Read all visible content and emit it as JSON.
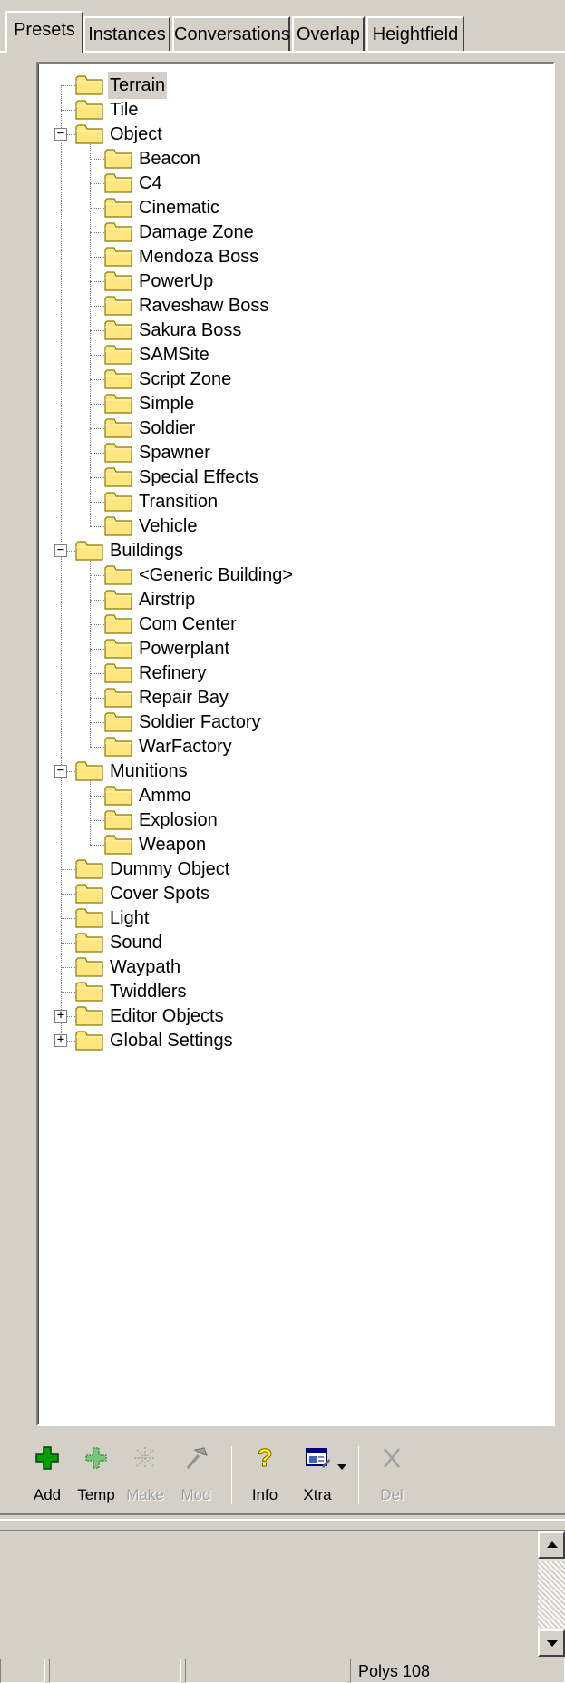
{
  "tabs": [
    {
      "label": "Presets",
      "active": true
    },
    {
      "label": "Instances",
      "active": false
    },
    {
      "label": "Conversations",
      "active": false
    },
    {
      "label": "Overlap",
      "active": false
    },
    {
      "label": "Heightfield",
      "active": false
    }
  ],
  "tree": {
    "selected": "Terrain",
    "items": [
      {
        "label": "Terrain",
        "depth": 0,
        "expander": null,
        "selected": true
      },
      {
        "label": "Tile",
        "depth": 0,
        "expander": null
      },
      {
        "label": "Object",
        "depth": 0,
        "expander": "minus"
      },
      {
        "label": "Beacon",
        "depth": 1
      },
      {
        "label": "C4",
        "depth": 1
      },
      {
        "label": "Cinematic",
        "depth": 1
      },
      {
        "label": "Damage Zone",
        "depth": 1
      },
      {
        "label": "Mendoza Boss",
        "depth": 1
      },
      {
        "label": "PowerUp",
        "depth": 1
      },
      {
        "label": "Raveshaw Boss",
        "depth": 1
      },
      {
        "label": "Sakura Boss",
        "depth": 1
      },
      {
        "label": "SAMSite",
        "depth": 1
      },
      {
        "label": "Script Zone",
        "depth": 1
      },
      {
        "label": "Simple",
        "depth": 1
      },
      {
        "label": "Soldier",
        "depth": 1
      },
      {
        "label": "Spawner",
        "depth": 1
      },
      {
        "label": "Special Effects",
        "depth": 1
      },
      {
        "label": "Transition",
        "depth": 1
      },
      {
        "label": "Vehicle",
        "depth": 1
      },
      {
        "label": "Buildings",
        "depth": 0,
        "expander": "minus"
      },
      {
        "label": "<Generic Building>",
        "depth": 1
      },
      {
        "label": "Airstrip",
        "depth": 1
      },
      {
        "label": "Com Center",
        "depth": 1
      },
      {
        "label": "Powerplant",
        "depth": 1
      },
      {
        "label": "Refinery",
        "depth": 1
      },
      {
        "label": "Repair Bay",
        "depth": 1
      },
      {
        "label": "Soldier Factory",
        "depth": 1
      },
      {
        "label": "WarFactory",
        "depth": 1
      },
      {
        "label": "Munitions",
        "depth": 0,
        "expander": "minus"
      },
      {
        "label": "Ammo",
        "depth": 1
      },
      {
        "label": "Explosion",
        "depth": 1
      },
      {
        "label": "Weapon",
        "depth": 1
      },
      {
        "label": "Dummy Object",
        "depth": 0,
        "expander": null
      },
      {
        "label": "Cover Spots",
        "depth": 0,
        "expander": null
      },
      {
        "label": "Light",
        "depth": 0,
        "expander": null
      },
      {
        "label": "Sound",
        "depth": 0,
        "expander": null
      },
      {
        "label": "Waypath",
        "depth": 0,
        "expander": null
      },
      {
        "label": "Twiddlers",
        "depth": 0,
        "expander": null
      },
      {
        "label": "Editor Objects",
        "depth": 0,
        "expander": "plus"
      },
      {
        "label": "Global Settings",
        "depth": 0,
        "expander": "plus"
      }
    ]
  },
  "toolbar": {
    "buttons": [
      {
        "label": "Add",
        "icon": "add-icon",
        "enabled": true
      },
      {
        "label": "Temp",
        "icon": "temp-icon",
        "enabled": true
      },
      {
        "label": "Make",
        "icon": "make-icon",
        "enabled": false
      },
      {
        "label": "Mod",
        "icon": "hammer-icon",
        "enabled": false
      },
      {
        "label": "Info",
        "icon": "question-icon",
        "enabled": true
      },
      {
        "label": "Xtra",
        "icon": "xtra-icon",
        "enabled": true
      },
      {
        "label": "Del",
        "icon": "delete-icon",
        "enabled": false
      }
    ]
  },
  "colors": {
    "folder_fill": "#ffe680",
    "folder_stroke": "#8a7a00",
    "add_green": "#00a000",
    "info_yellow": "#ffff00"
  },
  "statusbar": {
    "panels": [
      "",
      "",
      "",
      "Polys 108"
    ]
  }
}
